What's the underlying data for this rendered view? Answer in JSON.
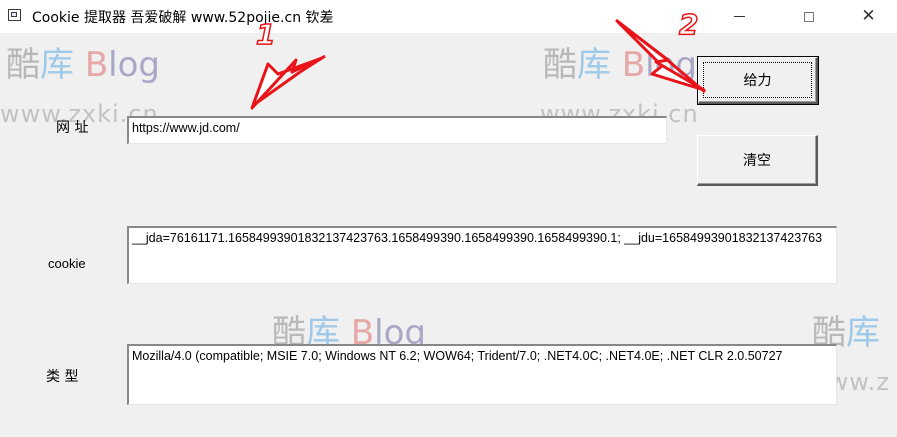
{
  "window": {
    "title": "Cookie 提取器 吾爱破解 www.52pojie.cn 钦差",
    "min_glyph": "",
    "close_glyph": "✕"
  },
  "form": {
    "url_label": "网 址",
    "url_value": "https://www.jd.com/",
    "cookie_label": "cookie",
    "cookie_value": "__jda=76161171.1658499390183213742376​3.1658499390.1658499390.1658499390.1; __jdu=1658499390183213742376​3",
    "type_label": "类 型",
    "type_value": "Mozilla/4.0 (compatible; MSIE 7.0; Windows NT 6.2; WOW64; Trident/7.0; .NET4.0C; .NET4.0E; .NET CLR 2.0.50727"
  },
  "buttons": {
    "go_label": "给力",
    "clear_label": "清空"
  },
  "watermark": {
    "chars": [
      "酷",
      "库",
      "B",
      "log"
    ],
    "site": "www.zxki.cn",
    "short_chars": [
      "酷",
      "库"
    ],
    "short_site": "www.z"
  },
  "annotations": {
    "marker_1": "1",
    "marker_2": "2",
    "arrow_color": "#e8141a"
  }
}
